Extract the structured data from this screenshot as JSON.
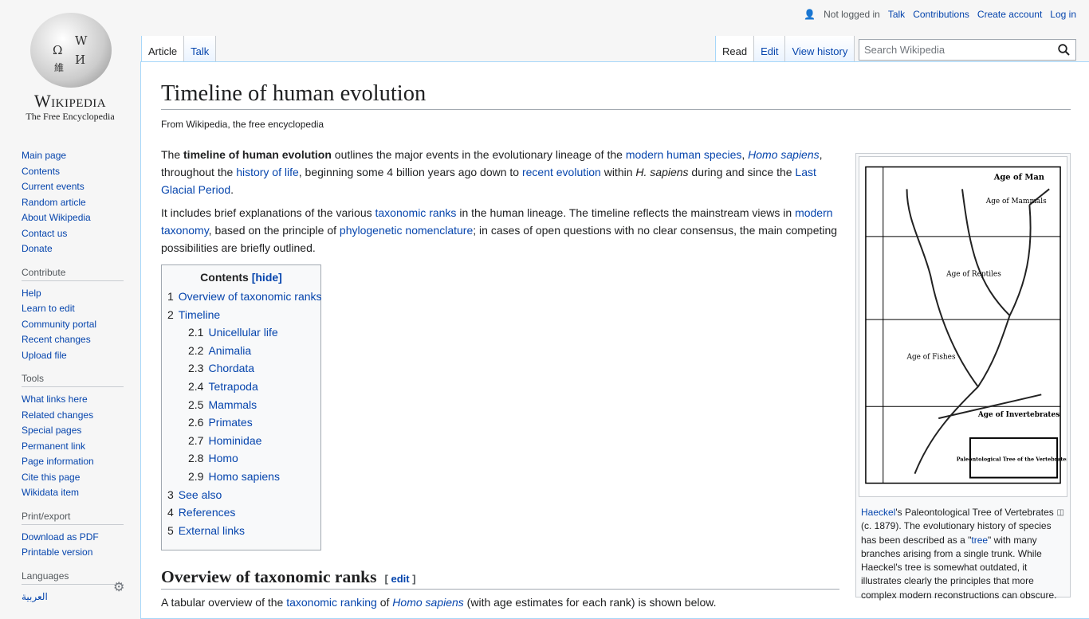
{
  "logo": {
    "wordmark": "Wikipedia",
    "tagline": "The Free Encyclopedia"
  },
  "personal": {
    "not_logged_in": "Not logged in",
    "talk": "Talk",
    "contributions": "Contributions",
    "create_account": "Create account",
    "log_in": "Log in"
  },
  "tabs": {
    "article": "Article",
    "talk": "Talk",
    "read": "Read",
    "edit": "Edit",
    "history": "View history"
  },
  "search": {
    "placeholder": "Search Wikipedia"
  },
  "sidebar": {
    "nav": [
      "Main page",
      "Contents",
      "Current events",
      "Random article",
      "About Wikipedia",
      "Contact us",
      "Donate"
    ],
    "contribute": {
      "heading": "Contribute",
      "items": [
        "Help",
        "Learn to edit",
        "Community portal",
        "Recent changes",
        "Upload file"
      ]
    },
    "tools": {
      "heading": "Tools",
      "items": [
        "What links here",
        "Related changes",
        "Special pages",
        "Permanent link",
        "Page information",
        "Cite this page",
        "Wikidata item"
      ]
    },
    "print": {
      "heading": "Print/export",
      "items": [
        "Download as PDF",
        "Printable version"
      ]
    },
    "languages": {
      "heading": "Languages",
      "items": [
        "العربية"
      ]
    }
  },
  "article": {
    "title": "Timeline of human evolution",
    "subtitle": "From Wikipedia, the free encyclopedia",
    "p1": [
      [
        "The ",
        0
      ],
      [
        "timeline of human evolution",
        2
      ],
      [
        " outlines the major events in the evolutionary lineage of the ",
        0
      ],
      [
        "modern human species",
        1
      ],
      [
        ", ",
        0
      ],
      [
        "Homo sapiens",
        3
      ],
      [
        ", throughout the ",
        0
      ],
      [
        "history of life",
        1
      ],
      [
        ", beginning some 4 billion years ago down to ",
        0
      ],
      [
        "recent evolution",
        1
      ],
      [
        " within ",
        0
      ],
      [
        "H. sapiens",
        4
      ],
      [
        " during and since the ",
        0
      ],
      [
        "Last Glacial Period",
        1
      ],
      [
        ".",
        0
      ]
    ],
    "p2": [
      [
        "It includes brief explanations of the various ",
        0
      ],
      [
        "taxonomic ranks",
        1
      ],
      [
        " in the human lineage. The timeline reflects the mainstream views in ",
        0
      ],
      [
        "modern taxonomy",
        1
      ],
      [
        ", based on the principle of ",
        0
      ],
      [
        "phylogenetic nomenclature",
        1
      ],
      [
        "; in cases of open questions with no clear consensus, the main competing possibilities are briefly outlined.",
        0
      ]
    ],
    "toc": {
      "title": "Contents",
      "hide": "[hide]",
      "items": [
        {
          "n": "1",
          "t": "Overview of taxonomic ranks",
          "sub": false
        },
        {
          "n": "2",
          "t": "Timeline",
          "sub": false
        },
        {
          "n": "2.1",
          "t": "Unicellular life",
          "sub": true
        },
        {
          "n": "2.2",
          "t": "Animalia",
          "sub": true
        },
        {
          "n": "2.3",
          "t": "Chordata",
          "sub": true
        },
        {
          "n": "2.4",
          "t": "Tetrapoda",
          "sub": true
        },
        {
          "n": "2.5",
          "t": "Mammals",
          "sub": true
        },
        {
          "n": "2.6",
          "t": "Primates",
          "sub": true
        },
        {
          "n": "2.7",
          "t": "Hominidae",
          "sub": true
        },
        {
          "n": "2.8",
          "t": "Homo",
          "sub": true
        },
        {
          "n": "2.9",
          "t": "Homo sapiens",
          "sub": true
        },
        {
          "n": "3",
          "t": "See also",
          "sub": false
        },
        {
          "n": "4",
          "t": "References",
          "sub": false
        },
        {
          "n": "5",
          "t": "External links",
          "sub": false
        }
      ]
    },
    "h2": "Overview of taxonomic ranks",
    "h2_edit": "edit",
    "p3": [
      [
        "A tabular overview of the ",
        0
      ],
      [
        "taxonomic ranking",
        1
      ],
      [
        " of ",
        0
      ],
      [
        "Homo sapiens",
        3
      ],
      [
        " (with age estimates for each rank) is shown below.",
        0
      ]
    ],
    "figure": {
      "image_labels": [
        "Age of Man",
        "Age of Mammals",
        "Age of Reptiles",
        "Age of Fishes",
        "Age of Invertebrates",
        "Paleontological Tree of the Vertebrates."
      ],
      "caption": [
        [
          "Haeckel",
          1
        ],
        [
          "'s Paleontological Tree of Vertebrates (c. 1879). The evolutionary history of species has been described as a \"",
          0
        ],
        [
          "tree",
          1
        ],
        [
          "\" with many branches arising from a single trunk. While Haeckel's tree is somewhat outdated, it illustrates clearly the principles that more complex modern reconstructions can obscure.",
          0
        ]
      ]
    }
  }
}
